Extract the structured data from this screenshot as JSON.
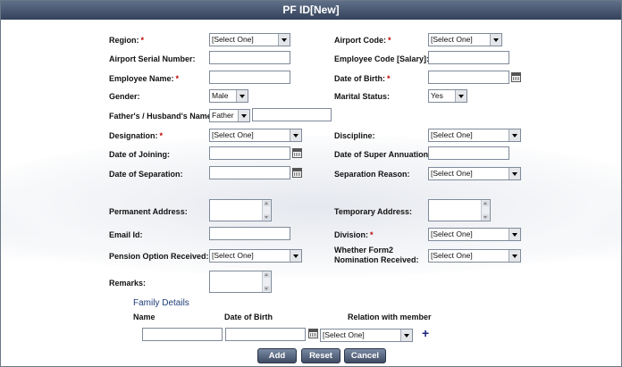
{
  "title": "PF ID[New]",
  "labels": {
    "region": "Region:",
    "airport_code": "Airport Code:",
    "airport_serial": "Airport Serial Number:",
    "employee_code": "Employee Code [Salary]:",
    "employee_name": "Employee Name:",
    "dob": "Date of Birth:",
    "gender": "Gender:",
    "marital": "Marital Status:",
    "father": "Father's / Husband's Name:",
    "designation": "Designation:",
    "discipline": "Discipline:",
    "doj": "Date of Joining:",
    "super_annuation": "Date of Super Annuation:",
    "separation_date": "Date of Separation:",
    "separation_reason": "Separation Reason:",
    "perm_address": "Permanent Address:",
    "temp_address": "Temporary Address:",
    "email": "Email Id:",
    "division": "Division:",
    "pension": "Pension Option Received:",
    "form2_line1": "Whether Form2",
    "form2_line2": "Nomination Received:",
    "remarks": "Remarks:"
  },
  "required_mark": "*",
  "values": {
    "region": "[Select One]",
    "airport_code": "[Select One]",
    "gender": "Male",
    "marital": "Yes",
    "relation_prefix": "Father",
    "designation": "[Select One]",
    "discipline": "[Select One]",
    "separation_reason": "[Select One]",
    "division": "[Select One]",
    "pension": "[Select One]",
    "form2": "[Select One]"
  },
  "family": {
    "heading": "Family Details",
    "col_name": "Name",
    "col_dob": "Date of Birth",
    "col_relation": "Relation with member",
    "relation_value": "[Select One]",
    "add_icon": "+"
  },
  "buttons": {
    "add": "Add",
    "reset": "Reset",
    "cancel": "Cancel"
  }
}
